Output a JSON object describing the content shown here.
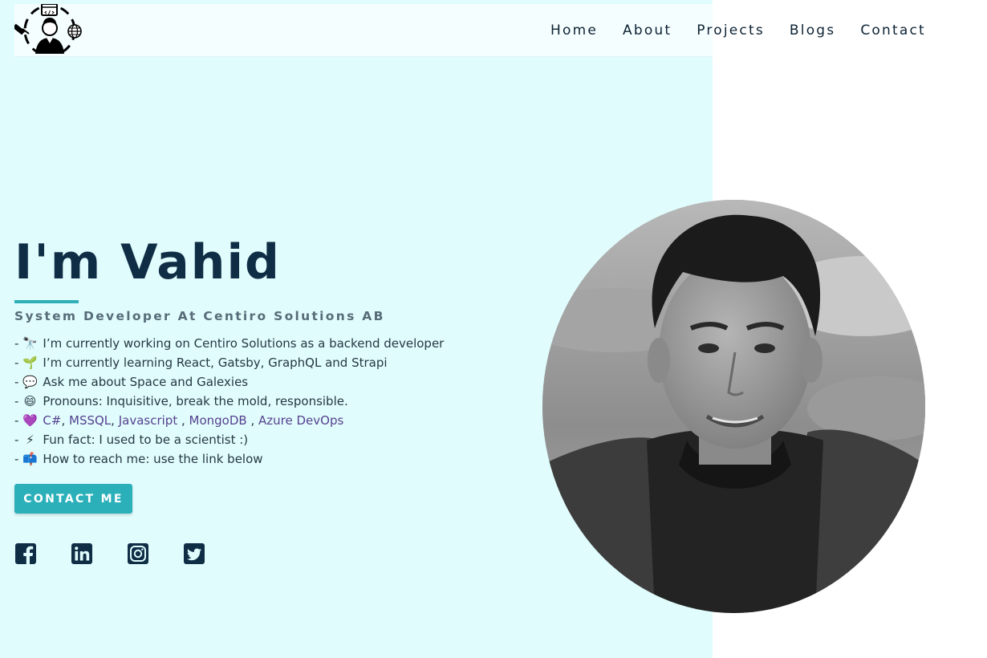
{
  "nav": {
    "links": [
      "Home",
      "About",
      "Projects",
      "Blogs",
      "Contact"
    ]
  },
  "hero": {
    "title": "I'm Vahid",
    "subtitle": "System Developer At Centiro Solutions AB",
    "facts": [
      {
        "icon": "telescope-icon",
        "text": "I’m currently working on Centiro Solutions as a backend developer"
      },
      {
        "icon": "seedling-icon",
        "text": "I’m currently learning React, Gatsby, GraphQL and Strapi"
      },
      {
        "icon": "speech-bubble-icon",
        "text": "Ask me about Space and Galexies"
      },
      {
        "icon": "grinning-face-icon",
        "text": "Pronouns: Inquisitive, break the mold, responsible."
      },
      {
        "icon": "purple-heart-icon",
        "links": [
          "C#",
          "MSSQL",
          "Javascript",
          "MongoDB",
          "Azure DevOps"
        ]
      },
      {
        "icon": "lightning-icon",
        "text": "Fun fact: I used to be a scientist :)"
      },
      {
        "icon": "mailbox-icon",
        "text": "How to reach me: use the link below"
      }
    ],
    "contact_label": "CONTACT ME"
  },
  "socials": [
    "facebook-icon",
    "linkedin-icon",
    "instagram-icon",
    "twitter-icon"
  ],
  "colors": {
    "background": "#e1fcfd",
    "accent": "#2bb0ba",
    "heading": "#0f2e46",
    "link": "#55418e"
  }
}
